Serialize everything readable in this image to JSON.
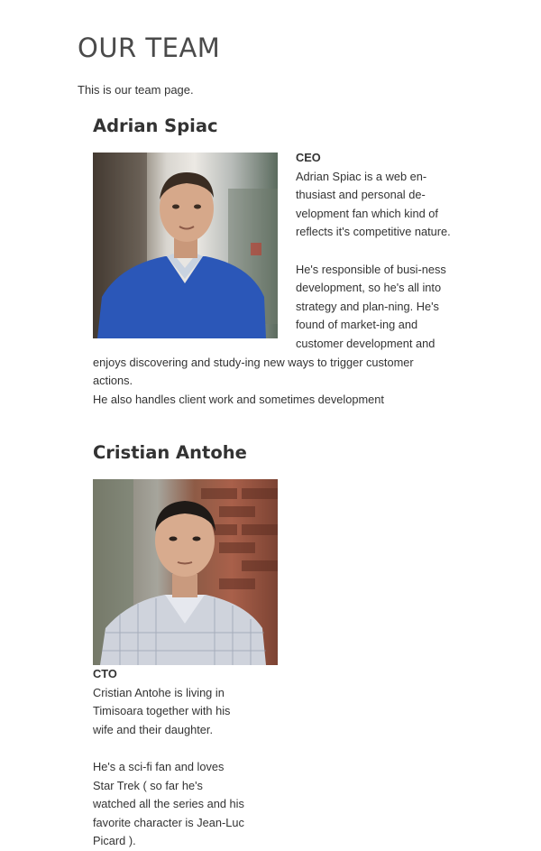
{
  "page": {
    "title": "OUR TEAM",
    "intro": "This is our team page."
  },
  "members": [
    {
      "name": "Adrian Spiac",
      "role": "CEO",
      "bio_1": "Adrian Spiac is a web en-thusiast and personal de-velopment fan which kind of reflects it's competitive nature.",
      "bio_2": "He's responsible of busi-ness development, so he's all into strategy and plan-ning. He's found of market-ing and customer development and enjoys discovering and study-ing new ways to trigger customer actions.",
      "bio_3": "He also handles client work and sometimes development"
    },
    {
      "name": "Cristian Antohe",
      "role": "CTO",
      "bio_1": "Cristian Antohe is living in Timisoara together with his wife and their daughter.",
      "bio_2": "He's a sci-fi fan and loves Star Trek ( so far he's watched all the series and his favorite character is Jean-Luc Picard )."
    }
  ]
}
